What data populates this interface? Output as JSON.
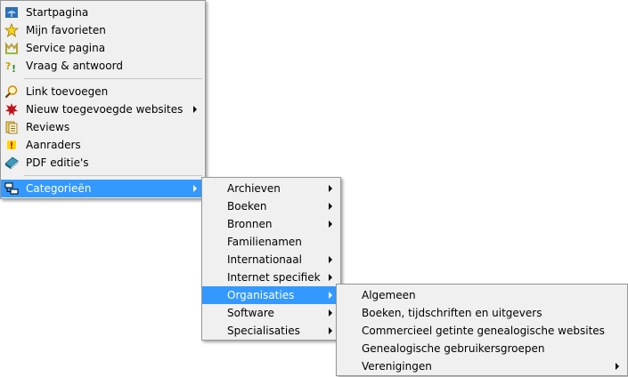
{
  "main_menu": {
    "group1": [
      {
        "label": "Startpagina",
        "icon": "home-umbrella-icon"
      },
      {
        "label": "Mijn favorieten",
        "icon": "star-icon"
      },
      {
        "label": "Service pagina",
        "icon": "service-m-icon"
      },
      {
        "label": "Vraag & antwoord",
        "icon": "question-answer-icon"
      }
    ],
    "group2": [
      {
        "label": "Link toevoegen",
        "icon": "magnifier-icon"
      },
      {
        "label": "Nieuw toegevoegde websites",
        "icon": "new-splat-icon",
        "has_submenu": true
      },
      {
        "label": "Reviews",
        "icon": "reviews-document-icon"
      },
      {
        "label": "Aanraders",
        "icon": "exclamation-icon"
      },
      {
        "label": "PDF editie's",
        "icon": "book-icon"
      }
    ],
    "group3": [
      {
        "label": "Categorieën",
        "icon": "categories-tree-icon",
        "has_submenu": true,
        "selected": true
      }
    ]
  },
  "categories_menu": {
    "items": [
      {
        "label": "Archieven",
        "has_submenu": true
      },
      {
        "label": "Boeken",
        "has_submenu": true
      },
      {
        "label": "Bronnen",
        "has_submenu": true
      },
      {
        "label": "Familienamen",
        "has_submenu": false
      },
      {
        "label": "Internationaal",
        "has_submenu": true
      },
      {
        "label": "Internet specifiek",
        "has_submenu": true
      },
      {
        "label": "Organisaties",
        "has_submenu": true,
        "selected": true
      },
      {
        "label": "Software",
        "has_submenu": true
      },
      {
        "label": "Specialisaties",
        "has_submenu": true
      }
    ]
  },
  "organisaties_menu": {
    "items": [
      {
        "label": "Algemeen",
        "has_submenu": false
      },
      {
        "label": "Boeken, tijdschriften en uitgevers",
        "has_submenu": false
      },
      {
        "label": "Commercieel getinte genealogische websites",
        "has_submenu": false
      },
      {
        "label": "Genealogische gebruikersgroepen",
        "has_submenu": false
      },
      {
        "label": "Verenigingen",
        "has_submenu": true
      }
    ]
  },
  "colors": {
    "menu_bg": "#f0f0f0",
    "highlight": "#3399ff",
    "border": "#979797"
  }
}
